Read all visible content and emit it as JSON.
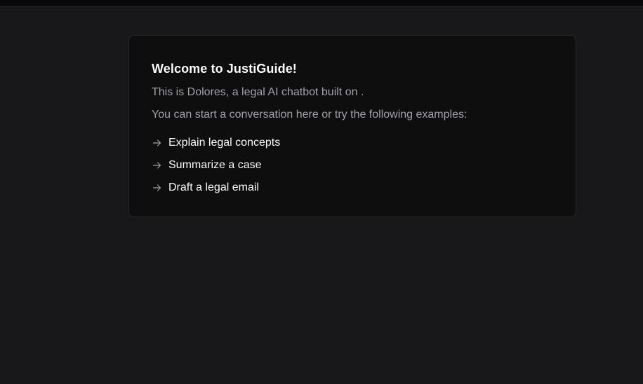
{
  "welcome": {
    "title": "Welcome to JustiGuide!",
    "intro": "This is Dolores, a legal AI chatbot built on .",
    "instructions": "You can start a conversation here or try the following examples:",
    "examples": [
      {
        "label": "Explain legal concepts",
        "icon": "arrow-right-icon"
      },
      {
        "label": "Summarize a case",
        "icon": "arrow-right-icon"
      },
      {
        "label": "Draft a legal email",
        "icon": "arrow-right-icon"
      }
    ]
  },
  "colors": {
    "background": "#18181b",
    "card_background": "#0e0e0f",
    "card_border": "#27272a",
    "text_primary": "#fafafa",
    "text_muted": "#a1a1aa"
  }
}
